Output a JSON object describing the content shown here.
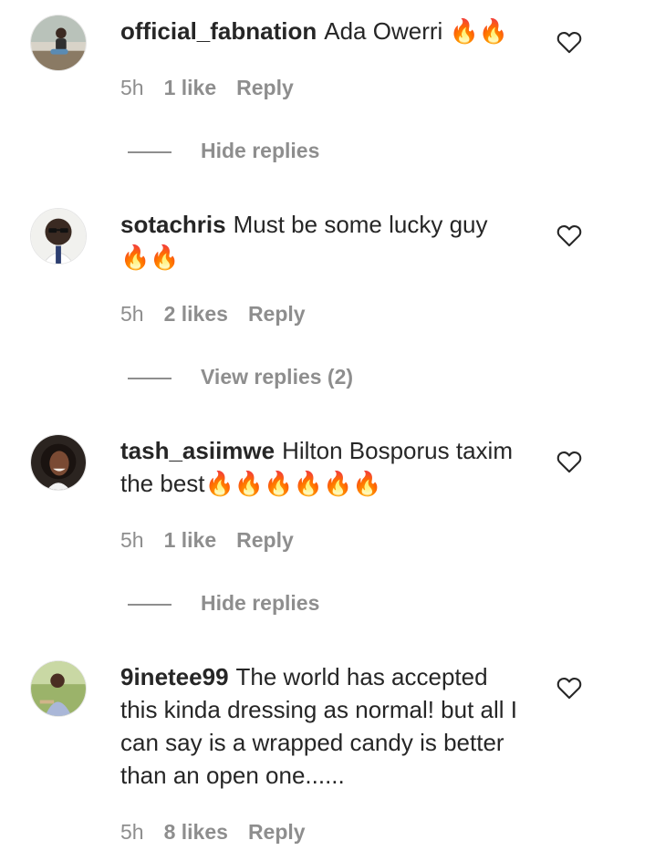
{
  "comments": [
    {
      "username": "official_fabnation",
      "text": "Ada Owerri 🔥🔥",
      "time": "5h",
      "likes": "1 like",
      "reply": "Reply",
      "replies_toggle": "Hide replies"
    },
    {
      "username": "sotachris",
      "text": "Must be some lucky guy 🔥🔥",
      "time": "5h",
      "likes": "2 likes",
      "reply": "Reply",
      "replies_toggle": "View replies (2)"
    },
    {
      "username": "tash_asiimwe",
      "text": "Hilton Bosporus taxim the best🔥🔥🔥🔥🔥🔥",
      "time": "5h",
      "likes": "1 like",
      "reply": "Reply",
      "replies_toggle": "Hide replies"
    },
    {
      "username": "9inetee99",
      "text": "The world has accepted this kinda dressing as normal! but all I can say is a wrapped candy is better than an open one......",
      "time": "5h",
      "likes": "8 likes",
      "reply": "Reply"
    }
  ],
  "icons": {
    "like": "heart-outline-icon"
  },
  "colors": {
    "text": "#262626",
    "meta": "#8e8e8e"
  }
}
